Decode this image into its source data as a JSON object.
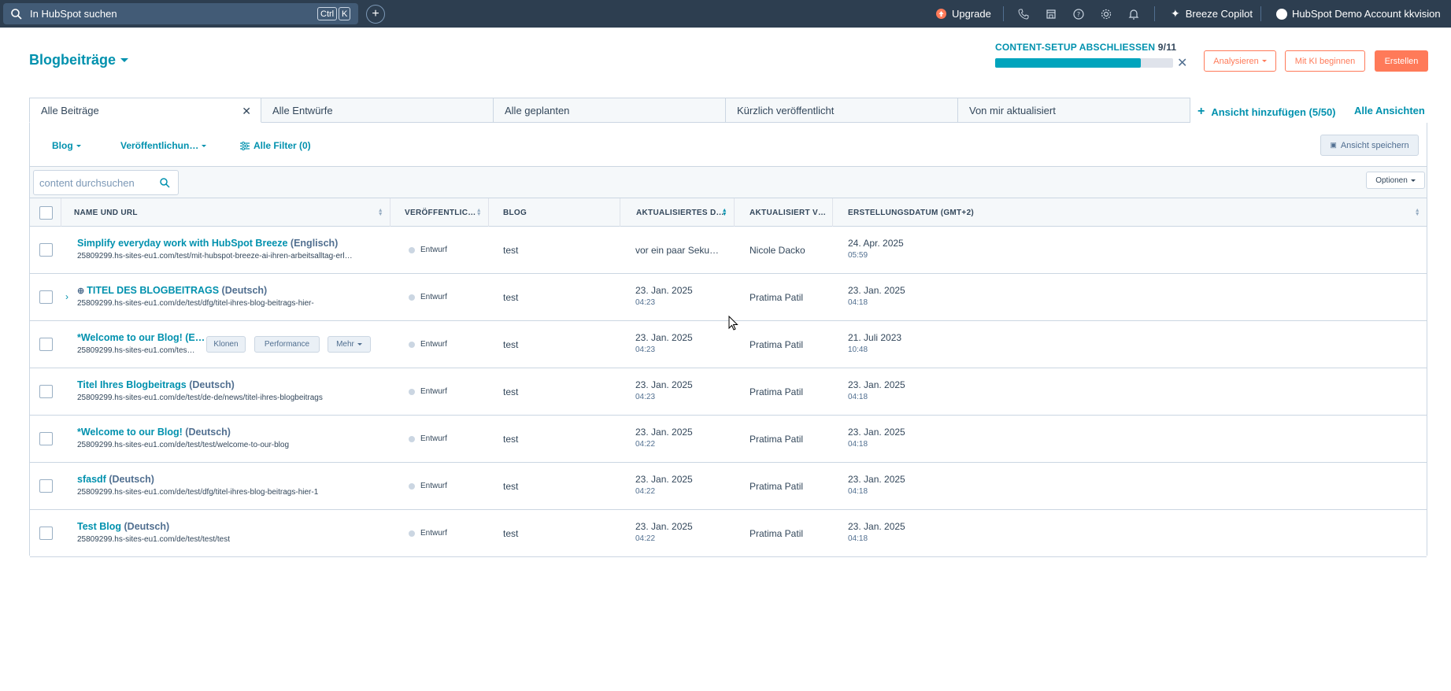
{
  "topnav": {
    "search_placeholder": "In HubSpot suchen",
    "kbd_ctrl": "Ctrl",
    "kbd_k": "K",
    "upgrade": "Upgrade",
    "copilot": "Breeze Copilot",
    "account": "HubSpot Demo Account kkvision",
    "icons": [
      "search-icon",
      "add-icon",
      "upgrade-icon",
      "phone-icon",
      "marketplace-icon",
      "help-icon",
      "settings-icon",
      "notifications-icon",
      "sparkle-icon",
      "avatar-icon"
    ]
  },
  "header": {
    "title": "Blogbeiträge",
    "setup_label": "CONTENT-SETUP ABSCHLIESSEN",
    "setup_count": "9/11",
    "setup_progress": 0.82,
    "analyze": "Analysieren",
    "ai_start": "Mit KI beginnen",
    "create": "Erstellen"
  },
  "tabs": [
    "Alle Beiträge",
    "Alle Entwürfe",
    "Alle geplanten",
    "Kürzlich veröffentlicht",
    "Von mir aktualisiert"
  ],
  "add_view": "Ansicht hinzufügen (5/50)",
  "all_views": "Alle Ansichten",
  "filters": {
    "blog": "Blog",
    "published": "Veröffentlichun…",
    "all_filters": "Alle Filter (0)",
    "save_view": "Ansicht speichern"
  },
  "toolbar": {
    "search_placeholder": "content durchsuchen",
    "options": "Optionen"
  },
  "columns": {
    "name": "NAME UND URL",
    "published": "VERÖFFENTLIC…",
    "blog": "BLOG",
    "updated": "AKTUALISIERTES D…",
    "updated_by": "AKTUALISIERT V…",
    "created": "ERSTELLUNGSDATUM (GMT+2)"
  },
  "rows": [
    {
      "title": "Simplify everyday work with HubSpot Breeze",
      "lang": "(Englisch)",
      "url": "25809299.hs-sites-eu1.com/test/mit-hubspot-breeze-ai-ihren-arbeitsalltag-erl…",
      "status": "Entwurf",
      "blog": "test",
      "updated": "vor ein paar Seku…",
      "updated_time": "",
      "by": "Nicole Dacko",
      "created": "24. Apr. 2025",
      "created_time": "05:59"
    },
    {
      "title": "TITEL DES BLOGBEITRAGS",
      "lang": "(Deutsch)",
      "url": "25809299.hs-sites-eu1.com/de/test/dfg/titel-ihres-blog-beitrags-hier-",
      "status": "Entwurf",
      "blog": "test",
      "updated": "23. Jan. 2025",
      "updated_time": "04:23",
      "by": "Pratima Patil",
      "created": "23. Jan. 2025",
      "created_time": "04:18"
    },
    {
      "title": "*Welcome to our Blog! (E…",
      "lang": "",
      "url": "25809299.hs-sites-eu1.com/tes…",
      "status": "Entwurf",
      "blog": "test",
      "updated": "23. Jan. 2025",
      "updated_time": "04:23",
      "by": "Pratima Patil",
      "created": "21. Juli 2023",
      "created_time": "10:48"
    },
    {
      "title": "Titel Ihres Blogbeitrags",
      "lang": "(Deutsch)",
      "url": "25809299.hs-sites-eu1.com/de/test/de-de/news/titel-ihres-blogbeitrags",
      "status": "Entwurf",
      "blog": "test",
      "updated": "23. Jan. 2025",
      "updated_time": "04:23",
      "by": "Pratima Patil",
      "created": "23. Jan. 2025",
      "created_time": "04:18"
    },
    {
      "title": "*Welcome to our Blog!",
      "lang": "(Deutsch)",
      "url": "25809299.hs-sites-eu1.com/de/test/test/welcome-to-our-blog",
      "status": "Entwurf",
      "blog": "test",
      "updated": "23. Jan. 2025",
      "updated_time": "04:22",
      "by": "Pratima Patil",
      "created": "23. Jan. 2025",
      "created_time": "04:18"
    },
    {
      "title": "sfasdf",
      "lang": "(Deutsch)",
      "url": "25809299.hs-sites-eu1.com/de/test/dfg/titel-ihres-blog-beitrags-hier-1",
      "status": "Entwurf",
      "blog": "test",
      "updated": "23. Jan. 2025",
      "updated_time": "04:22",
      "by": "Pratima Patil",
      "created": "23. Jan. 2025",
      "created_time": "04:18"
    },
    {
      "title": "Test Blog",
      "lang": "(Deutsch)",
      "url": "25809299.hs-sites-eu1.com/de/test/test/test",
      "status": "Entwurf",
      "blog": "test",
      "updated": "23. Jan. 2025",
      "updated_time": "04:22",
      "by": "Pratima Patil",
      "created": "23. Jan. 2025",
      "created_time": "04:18"
    }
  ],
  "hover_actions": {
    "clone": "Klonen",
    "performance": "Performance",
    "more": "Mehr"
  },
  "colors": {
    "nav_bg": "#2d3e50",
    "link": "#0091ae",
    "accent": "#ff7a59",
    "progress": "#00a4bd"
  }
}
